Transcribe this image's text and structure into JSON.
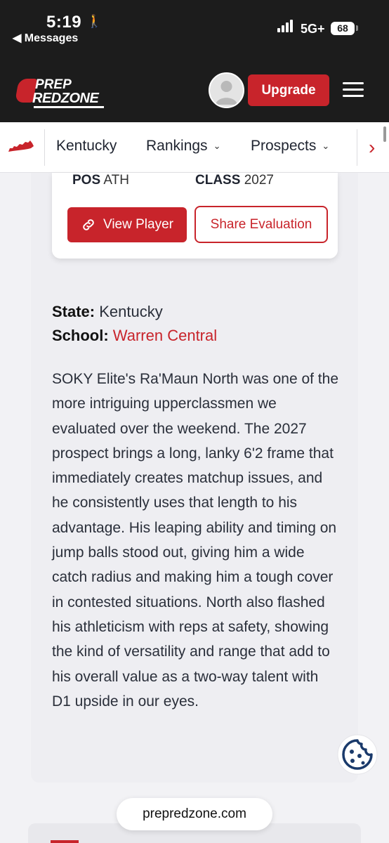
{
  "status_bar": {
    "time": "5:19",
    "back_app": "◀ Messages",
    "network": "5G+",
    "battery": "68"
  },
  "header": {
    "logo_line1": "PREP",
    "logo_line2": "REDZONE",
    "upgrade_label": "Upgrade"
  },
  "subnav": {
    "items": [
      "Kentucky",
      "Rankings",
      "Prospects"
    ]
  },
  "player": {
    "pos_label": "POS",
    "pos_value": "ATH",
    "class_label": "CLASS",
    "class_value": "2027",
    "view_label": "View Player",
    "share_label": "Share Evaluation"
  },
  "details": {
    "state_label": "State:",
    "state_value": "Kentucky",
    "school_label": "School:",
    "school_value": "Warren Central"
  },
  "evaluation": "SOKY Elite's Ra'Maun North was one of the more intriguing upperclassmen we evaluated over the weekend. The 2027 prospect brings a long, lanky 6'2 frame that immediately creates matchup issues, and he consistently uses that length to his advantage. His leaping ability and timing on jump balls stood out, giving him a wide catch radius and making him a tough cover in contested situations. North also flashed his athleticism with reps at safety, showing the kind of versatility and range that add to his overall value as a two-way talent with D1 upside in our eyes.",
  "browser": {
    "url": "prepredzone.com"
  },
  "colors": {
    "brand_red": "#c8242b",
    "header_bg": "#1c1c1c"
  }
}
